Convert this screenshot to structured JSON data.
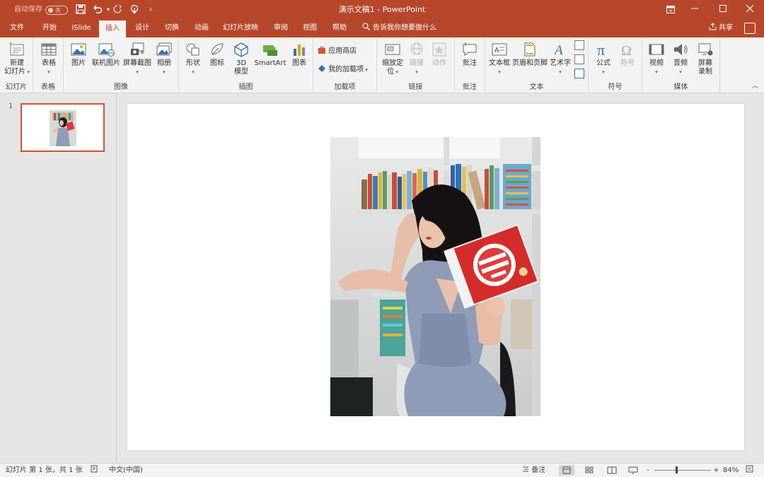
{
  "titlebar": {
    "autosave_label": "自动保存",
    "autosave_state": "关",
    "document_title": "演示文稿1 - PowerPoint",
    "icons": [
      "save-icon",
      "undo-icon",
      "redo-icon",
      "touch-mode-icon",
      "customize-qat-icon"
    ],
    "window_controls": [
      "ribbon-display-icon",
      "minimize-icon",
      "maximize-icon",
      "close-icon"
    ]
  },
  "tabs": [
    {
      "label": "文件"
    },
    {
      "label": "开始"
    },
    {
      "label": "iSlide"
    },
    {
      "label": "插入"
    },
    {
      "label": "设计"
    },
    {
      "label": "切换"
    },
    {
      "label": "动画"
    },
    {
      "label": "幻灯片放映"
    },
    {
      "label": "审阅"
    },
    {
      "label": "视图"
    },
    {
      "label": "帮助"
    }
  ],
  "active_tab": "插入",
  "tell_me": "告诉我你想要做什么",
  "share": "共享",
  "ribbon": {
    "slides": {
      "label": "幻灯片",
      "new_slide": "新建",
      "new_slide2": "幻灯片"
    },
    "tables": {
      "label": "表格",
      "table": "表格"
    },
    "images": {
      "label": "图像",
      "picture": "图片",
      "online_picture": "联机图片",
      "screenshot": "屏幕截图",
      "album": "相册"
    },
    "illustrations": {
      "label": "插图",
      "shapes": "形状",
      "icons": "图标",
      "model3d": "3D",
      "model3d2": "模型",
      "smartart": "SmartArt",
      "chart": "图表"
    },
    "addins": {
      "label": "加载项",
      "store": "应用商店",
      "my_addins": "我的加载项"
    },
    "links": {
      "label": "链接",
      "zoom": "缩放定",
      "zoom2": "位",
      "link": "链接",
      "action": "动作"
    },
    "comments": {
      "label": "批注",
      "comment": "批注"
    },
    "text": {
      "label": "文本",
      "textbox": "文本框",
      "header_footer": "页眉和页脚",
      "wordart": "艺术字"
    },
    "symbols": {
      "label": "符号",
      "equation": "公式",
      "symbol": "符号"
    },
    "media": {
      "label": "媒体",
      "video": "视频",
      "audio": "音频",
      "screen_record": "屏幕",
      "screen_record2": "录制"
    }
  },
  "thumbnails": [
    {
      "number": "1"
    }
  ],
  "status": {
    "slide_info": "幻灯片 第 1 张，共 1 张",
    "language": "中文(中国)",
    "notes": "备注",
    "zoom_minus": "-",
    "zoom_plus": "+",
    "zoom_percent": "84%"
  },
  "colors": {
    "accent": "#b7472a",
    "selection": "#d35230"
  }
}
